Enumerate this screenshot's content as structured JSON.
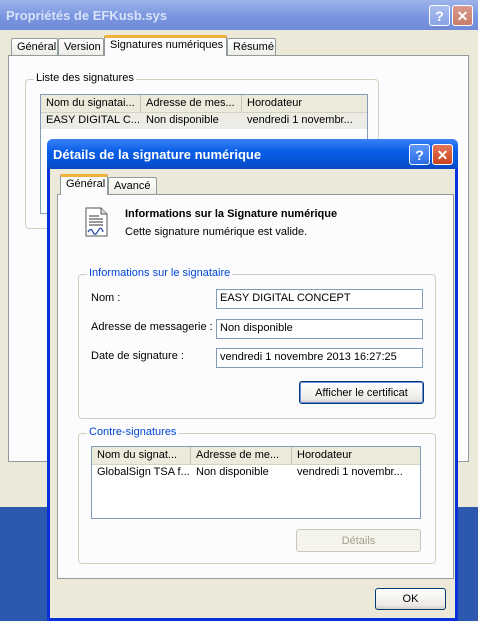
{
  "back_window": {
    "title": "Propriétés de EFKusb.sys",
    "tabs": [
      "Général",
      "Version",
      "Signatures numériques",
      "Résumé"
    ],
    "group_label": "Liste des signatures",
    "columns": [
      "Nom du signatai...",
      "Adresse de mes...",
      "Horodateur"
    ],
    "rows": [
      {
        "name": "EASY DIGITAL C...",
        "email": "Non disponible",
        "timestamp": "vendredi 1 novembr..."
      }
    ]
  },
  "dialog": {
    "title": "Détails de la signature numérique",
    "tabs": [
      "Général",
      "Avancé"
    ],
    "info": {
      "heading": "Informations sur la Signature numérique",
      "status": "Cette signature numérique est valide."
    },
    "signer": {
      "group_label": "Informations sur le signataire",
      "name_label": "Nom :",
      "name_value": "EASY DIGITAL CONCEPT",
      "email_label": "Adresse de messagerie :",
      "email_value": "Non disponible",
      "date_label": "Date de signature :",
      "date_value": "vendredi 1 novembre 2013 16:27:25",
      "view_cert_button": "Afficher le certificat"
    },
    "countersignatures": {
      "group_label": "Contre-signatures",
      "columns": [
        "Nom du signat...",
        "Adresse de me...",
        "Horodateur"
      ],
      "rows": [
        {
          "name": "GlobalSign TSA f...",
          "email": "Non disponible",
          "timestamp": "vendredi 1 novembr..."
        }
      ],
      "details_button": "Détails"
    },
    "ok_button": "OK"
  }
}
